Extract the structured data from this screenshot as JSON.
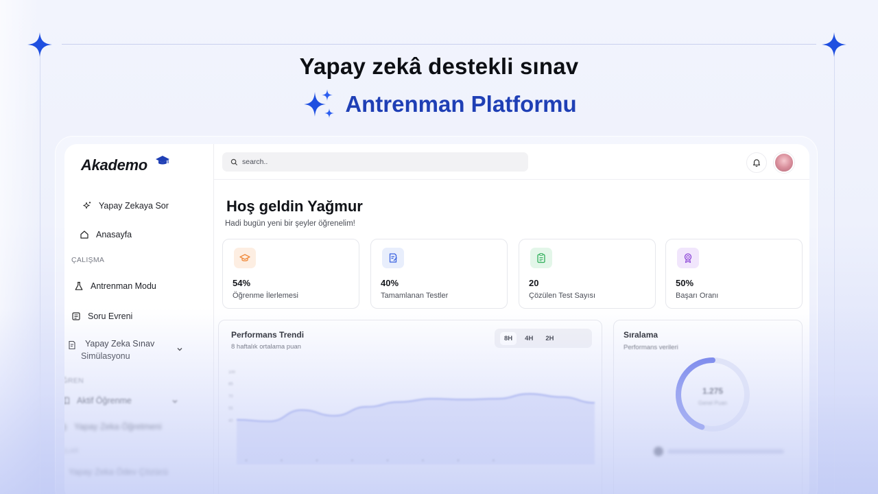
{
  "hero": {
    "title": "Yapay zekâ destekli sınav",
    "subtitle": "Antrenman Platformu"
  },
  "brand": {
    "logo": "Akademo",
    "accent": "#1f3fb5",
    "logo_icon": "graduation-cap-icon"
  },
  "search": {
    "placeholder": "search.."
  },
  "sidebar": {
    "ask_ai": "Yapay Zekaya Sor",
    "home": "Anasayfa",
    "section_study": "ÇALIŞMA",
    "practice_mode": "Antrenman Modu",
    "question_pool": "Soru Evreni",
    "exam_sim_1": "Yapay Zeka Sınav",
    "exam_sim_2": "Simülasyonu",
    "section_learn": "ÖĞREN",
    "active_learning": "Aktif Öğrenme",
    "ai_teacher": "Yapay Zeka Öğretmeni",
    "section_tools": "ARAÇLAR",
    "ai_homework": "Yapay Zeka Ödev Çözücü"
  },
  "welcome": {
    "title": "Hoş geldin Yağmur",
    "subtitle": "Hadi bugün yeni bir şeyler öğrenelim!"
  },
  "stats": [
    {
      "value": "54%",
      "label": "Öğrenme İlerlemesi",
      "icon": "graduation-cap-icon",
      "color": "#f08a3c",
      "bg": "#fdeee2"
    },
    {
      "value": "40%",
      "label": "Tamamlanan Testler",
      "icon": "edit-document-icon",
      "color": "#3b63e0",
      "bg": "#e8eefc"
    },
    {
      "value": "20",
      "label": "Çözülen Test Sayısı",
      "icon": "clipboard-list-icon",
      "color": "#2fae5a",
      "bg": "#e3f6e9"
    },
    {
      "value": "50%",
      "label": "Başarı Oranı",
      "icon": "award-badge-icon",
      "color": "#8b45d6",
      "bg": "#f1e6fc"
    }
  ],
  "performance": {
    "title": "Performans Trendi",
    "subtitle": "8 haftalık ortalama puan",
    "ranges": [
      "8H",
      "4H",
      "2H"
    ],
    "active_range": "8H"
  },
  "ranking": {
    "title": "Sıralama",
    "subtitle": "Performans verileri",
    "value": "1.275",
    "value_label": "Genel Puan",
    "progress": 0.62
  },
  "chart_data": {
    "type": "area",
    "title": "Performans Trendi",
    "subtitle": "8 haftalık ortalama puan",
    "ylim": [
      0,
      100
    ],
    "yticks": [
      100,
      85,
      70,
      55,
      40
    ],
    "x": [
      1,
      2,
      3,
      4,
      5,
      6,
      7,
      8
    ],
    "values": [
      40,
      38,
      52,
      45,
      56,
      62,
      66,
      65,
      66,
      72,
      68,
      61
    ],
    "color": "#6f7fe0"
  }
}
